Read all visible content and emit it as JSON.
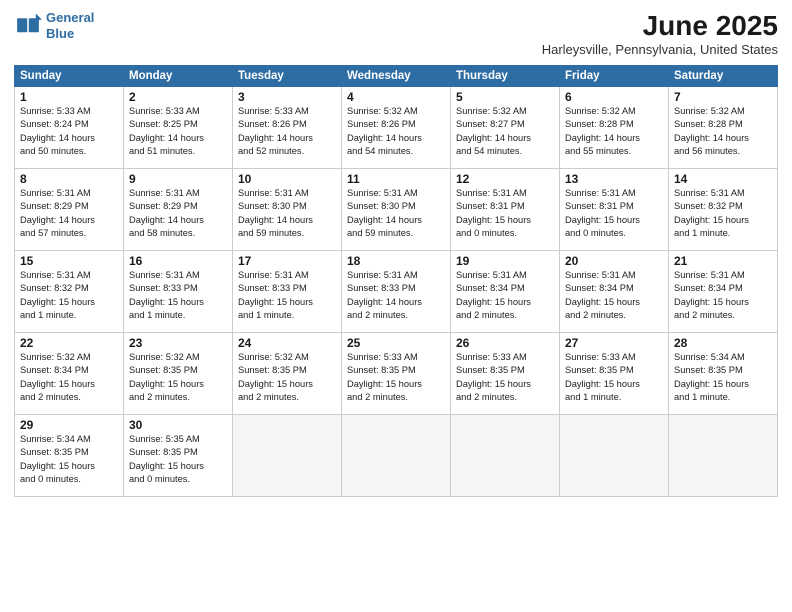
{
  "header": {
    "logo_line1": "General",
    "logo_line2": "Blue",
    "month": "June 2025",
    "location": "Harleysville, Pennsylvania, United States"
  },
  "weekdays": [
    "Sunday",
    "Monday",
    "Tuesday",
    "Wednesday",
    "Thursday",
    "Friday",
    "Saturday"
  ],
  "weeks": [
    [
      {
        "day": "1",
        "info": "Sunrise: 5:33 AM\nSunset: 8:24 PM\nDaylight: 14 hours\nand 50 minutes."
      },
      {
        "day": "2",
        "info": "Sunrise: 5:33 AM\nSunset: 8:25 PM\nDaylight: 14 hours\nand 51 minutes."
      },
      {
        "day": "3",
        "info": "Sunrise: 5:33 AM\nSunset: 8:26 PM\nDaylight: 14 hours\nand 52 minutes."
      },
      {
        "day": "4",
        "info": "Sunrise: 5:32 AM\nSunset: 8:26 PM\nDaylight: 14 hours\nand 54 minutes."
      },
      {
        "day": "5",
        "info": "Sunrise: 5:32 AM\nSunset: 8:27 PM\nDaylight: 14 hours\nand 54 minutes."
      },
      {
        "day": "6",
        "info": "Sunrise: 5:32 AM\nSunset: 8:28 PM\nDaylight: 14 hours\nand 55 minutes."
      },
      {
        "day": "7",
        "info": "Sunrise: 5:32 AM\nSunset: 8:28 PM\nDaylight: 14 hours\nand 56 minutes."
      }
    ],
    [
      {
        "day": "8",
        "info": "Sunrise: 5:31 AM\nSunset: 8:29 PM\nDaylight: 14 hours\nand 57 minutes."
      },
      {
        "day": "9",
        "info": "Sunrise: 5:31 AM\nSunset: 8:29 PM\nDaylight: 14 hours\nand 58 minutes."
      },
      {
        "day": "10",
        "info": "Sunrise: 5:31 AM\nSunset: 8:30 PM\nDaylight: 14 hours\nand 59 minutes."
      },
      {
        "day": "11",
        "info": "Sunrise: 5:31 AM\nSunset: 8:30 PM\nDaylight: 14 hours\nand 59 minutes."
      },
      {
        "day": "12",
        "info": "Sunrise: 5:31 AM\nSunset: 8:31 PM\nDaylight: 15 hours\nand 0 minutes."
      },
      {
        "day": "13",
        "info": "Sunrise: 5:31 AM\nSunset: 8:31 PM\nDaylight: 15 hours\nand 0 minutes."
      },
      {
        "day": "14",
        "info": "Sunrise: 5:31 AM\nSunset: 8:32 PM\nDaylight: 15 hours\nand 1 minute."
      }
    ],
    [
      {
        "day": "15",
        "info": "Sunrise: 5:31 AM\nSunset: 8:32 PM\nDaylight: 15 hours\nand 1 minute."
      },
      {
        "day": "16",
        "info": "Sunrise: 5:31 AM\nSunset: 8:33 PM\nDaylight: 15 hours\nand 1 minute."
      },
      {
        "day": "17",
        "info": "Sunrise: 5:31 AM\nSunset: 8:33 PM\nDaylight: 15 hours\nand 1 minute."
      },
      {
        "day": "18",
        "info": "Sunrise: 5:31 AM\nSunset: 8:33 PM\nDaylight: 14 hours\nand 2 minutes."
      },
      {
        "day": "19",
        "info": "Sunrise: 5:31 AM\nSunset: 8:34 PM\nDaylight: 15 hours\nand 2 minutes."
      },
      {
        "day": "20",
        "info": "Sunrise: 5:31 AM\nSunset: 8:34 PM\nDaylight: 15 hours\nand 2 minutes."
      },
      {
        "day": "21",
        "info": "Sunrise: 5:31 AM\nSunset: 8:34 PM\nDaylight: 15 hours\nand 2 minutes."
      }
    ],
    [
      {
        "day": "22",
        "info": "Sunrise: 5:32 AM\nSunset: 8:34 PM\nDaylight: 15 hours\nand 2 minutes."
      },
      {
        "day": "23",
        "info": "Sunrise: 5:32 AM\nSunset: 8:35 PM\nDaylight: 15 hours\nand 2 minutes."
      },
      {
        "day": "24",
        "info": "Sunrise: 5:32 AM\nSunset: 8:35 PM\nDaylight: 15 hours\nand 2 minutes."
      },
      {
        "day": "25",
        "info": "Sunrise: 5:33 AM\nSunset: 8:35 PM\nDaylight: 15 hours\nand 2 minutes."
      },
      {
        "day": "26",
        "info": "Sunrise: 5:33 AM\nSunset: 8:35 PM\nDaylight: 15 hours\nand 2 minutes."
      },
      {
        "day": "27",
        "info": "Sunrise: 5:33 AM\nSunset: 8:35 PM\nDaylight: 15 hours\nand 1 minute."
      },
      {
        "day": "28",
        "info": "Sunrise: 5:34 AM\nSunset: 8:35 PM\nDaylight: 15 hours\nand 1 minute."
      }
    ],
    [
      {
        "day": "29",
        "info": "Sunrise: 5:34 AM\nSunset: 8:35 PM\nDaylight: 15 hours\nand 0 minutes."
      },
      {
        "day": "30",
        "info": "Sunrise: 5:35 AM\nSunset: 8:35 PM\nDaylight: 15 hours\nand 0 minutes."
      },
      {
        "day": "",
        "info": ""
      },
      {
        "day": "",
        "info": ""
      },
      {
        "day": "",
        "info": ""
      },
      {
        "day": "",
        "info": ""
      },
      {
        "day": "",
        "info": ""
      }
    ]
  ]
}
